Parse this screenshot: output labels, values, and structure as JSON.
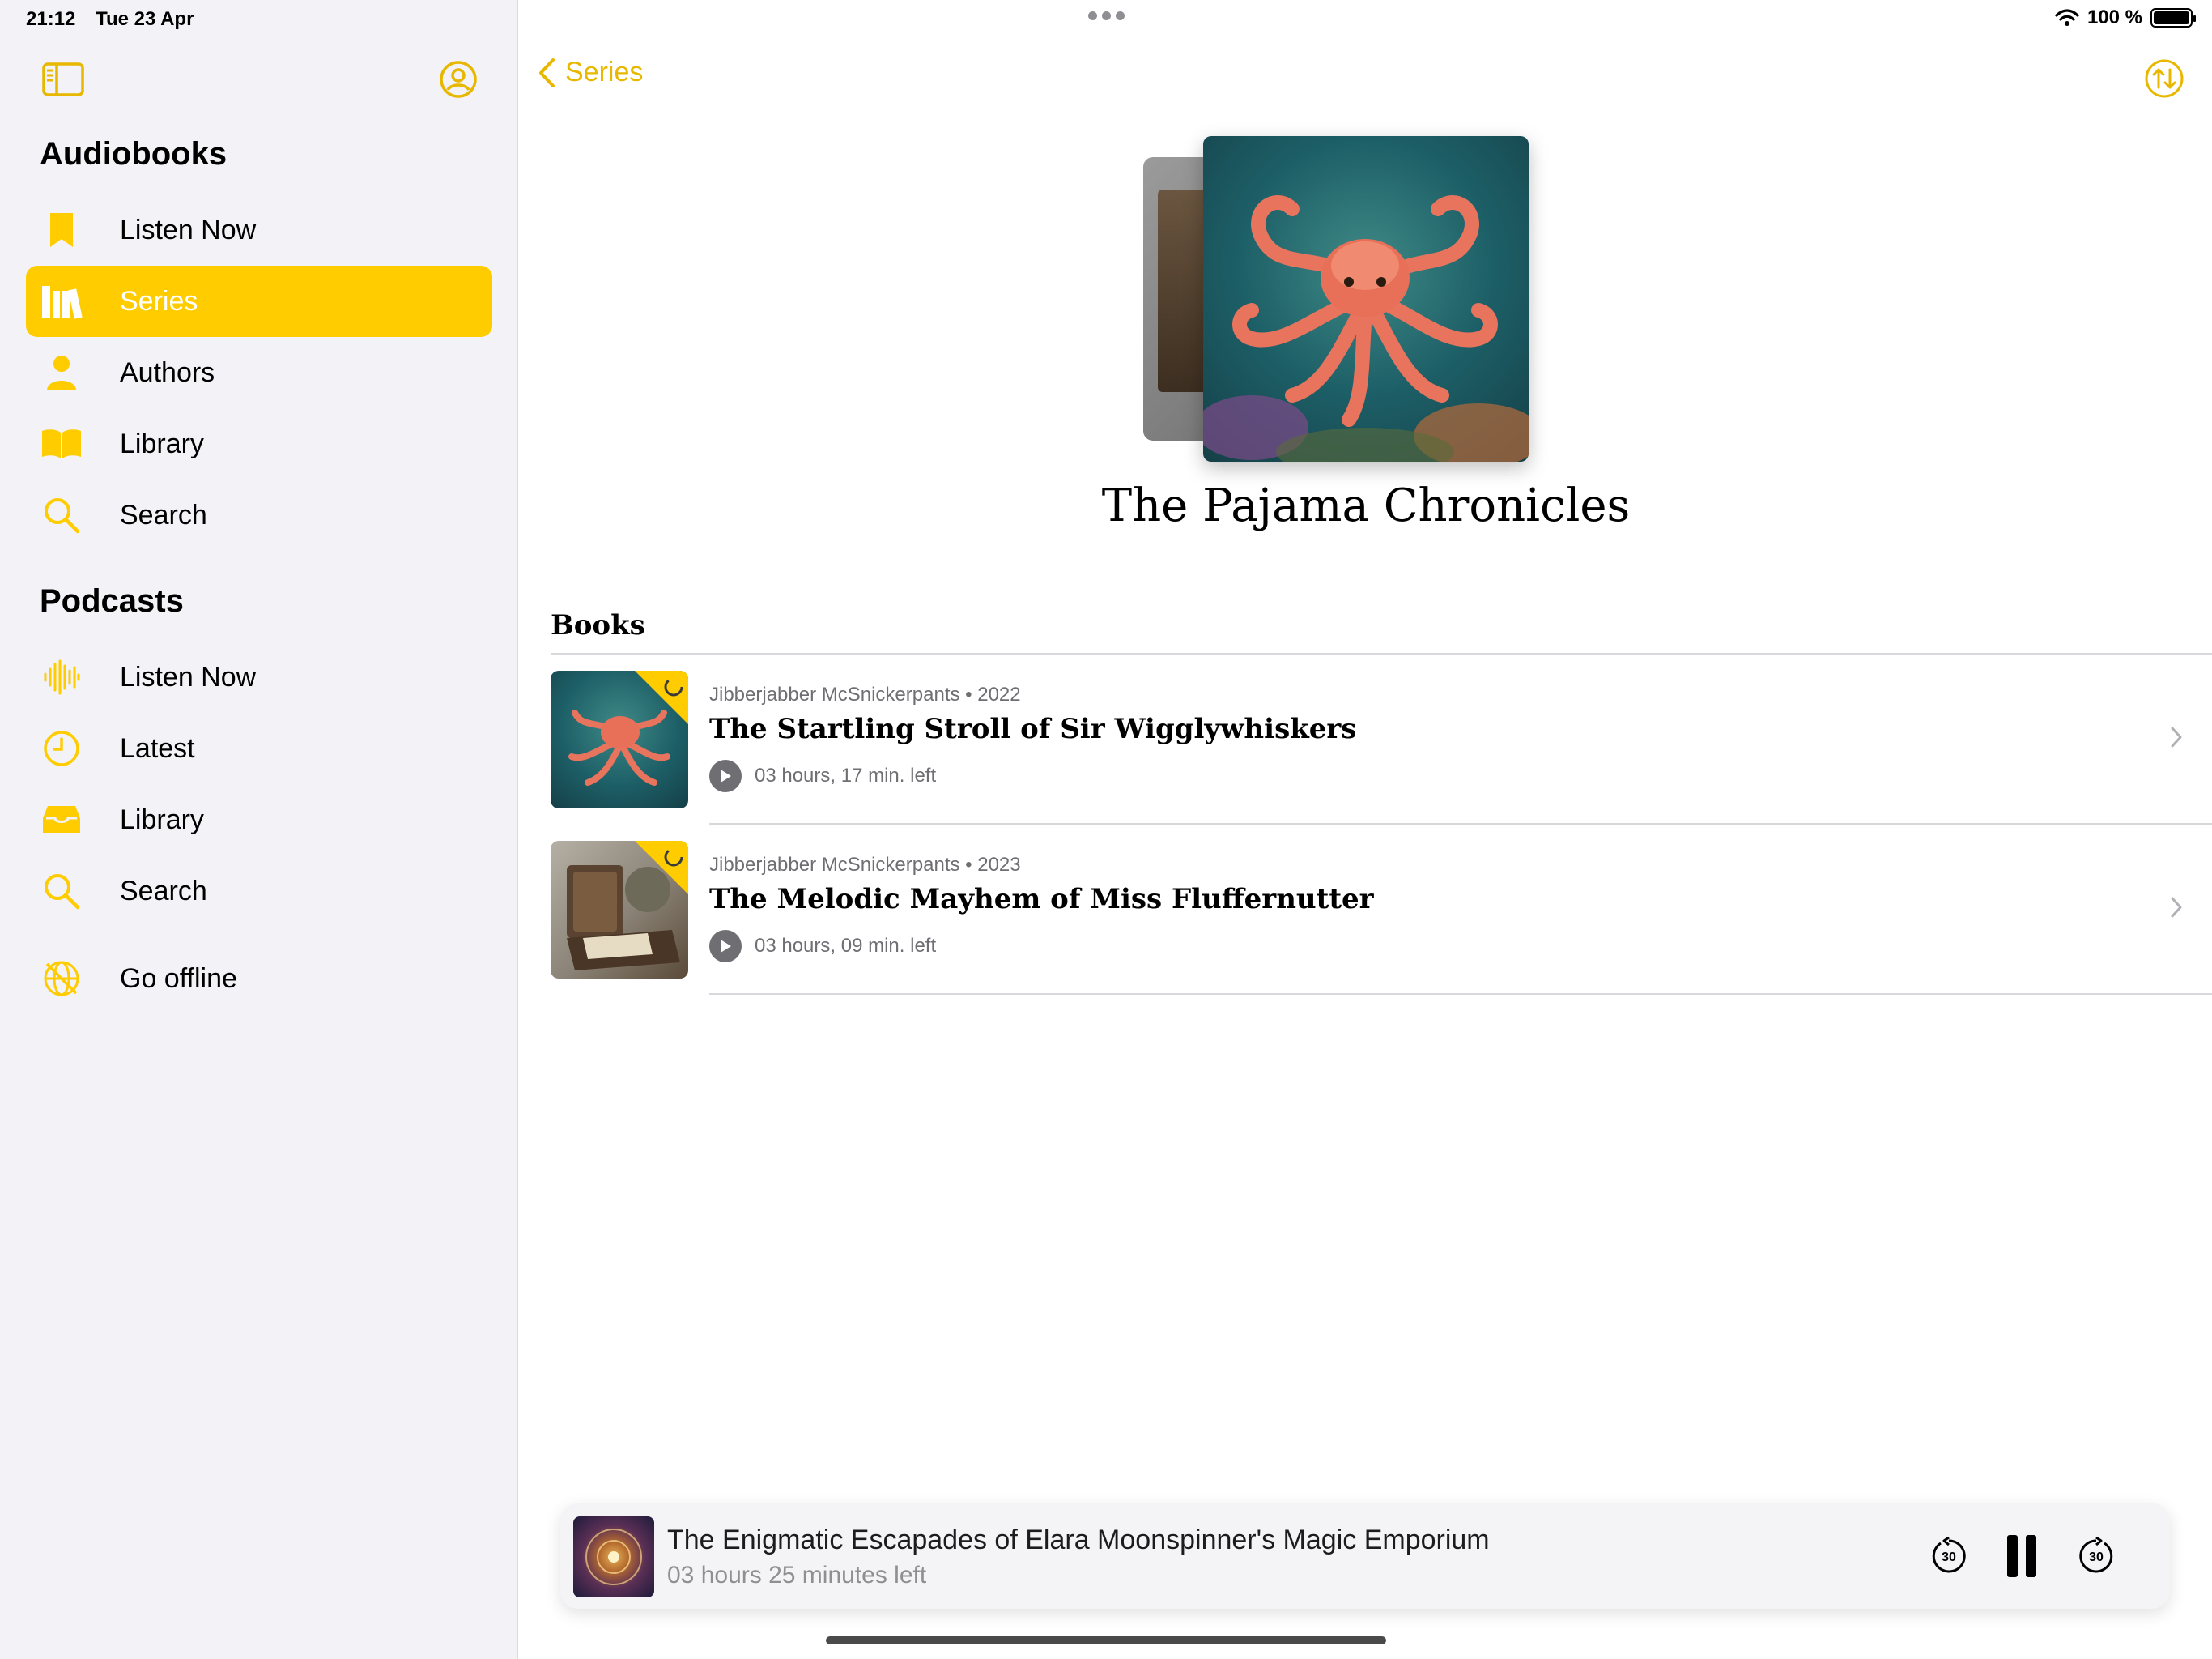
{
  "status_bar": {
    "time": "21:12",
    "date": "Tue 23 Apr",
    "battery": "100 %"
  },
  "sidebar": {
    "audiobooks_title": "Audiobooks",
    "audiobooks_items": [
      {
        "label": "Listen Now",
        "icon": "bookmark-icon"
      },
      {
        "label": "Series",
        "icon": "books-icon",
        "active": true
      },
      {
        "label": "Authors",
        "icon": "person-icon"
      },
      {
        "label": "Library",
        "icon": "open-book-icon"
      },
      {
        "label": "Search",
        "icon": "magnifier-icon"
      }
    ],
    "podcasts_title": "Podcasts",
    "podcasts_items": [
      {
        "label": "Listen Now",
        "icon": "waveform-icon"
      },
      {
        "label": "Latest",
        "icon": "clock-icon"
      },
      {
        "label": "Library",
        "icon": "tray-icon"
      },
      {
        "label": "Search",
        "icon": "magnifier-icon"
      }
    ],
    "offline_label": "Go offline"
  },
  "nav": {
    "back_label": "Series"
  },
  "series": {
    "title": "The Pajama Chronicles"
  },
  "books_section": {
    "heading": "Books",
    "books": [
      {
        "author": "Jibberjabber McSnickerpants",
        "year": "2022",
        "meta": "Jibberjabber McSnickerpants • 2022",
        "title": "The Startling Stroll of Sir Wigglywhiskers",
        "remaining": "03 hours, 17 min. left"
      },
      {
        "author": "Jibberjabber McSnickerpants",
        "year": "2023",
        "meta": "Jibberjabber McSnickerpants • 2023",
        "title": "The Melodic Mayhem of Miss Fluffernutter",
        "remaining": "03 hours, 09 min. left"
      }
    ]
  },
  "mini_player": {
    "title": "The Enigmatic Escapades of Elara Moonspinner's Magic Emporium",
    "subtitle": "03 hours 25 minutes left",
    "skip_back_label": "30",
    "skip_forward_label": "30"
  },
  "colors": {
    "accent": "#ffcc00",
    "accent_text": "#e8b800",
    "sidebar_bg": "#f2f2f7"
  }
}
